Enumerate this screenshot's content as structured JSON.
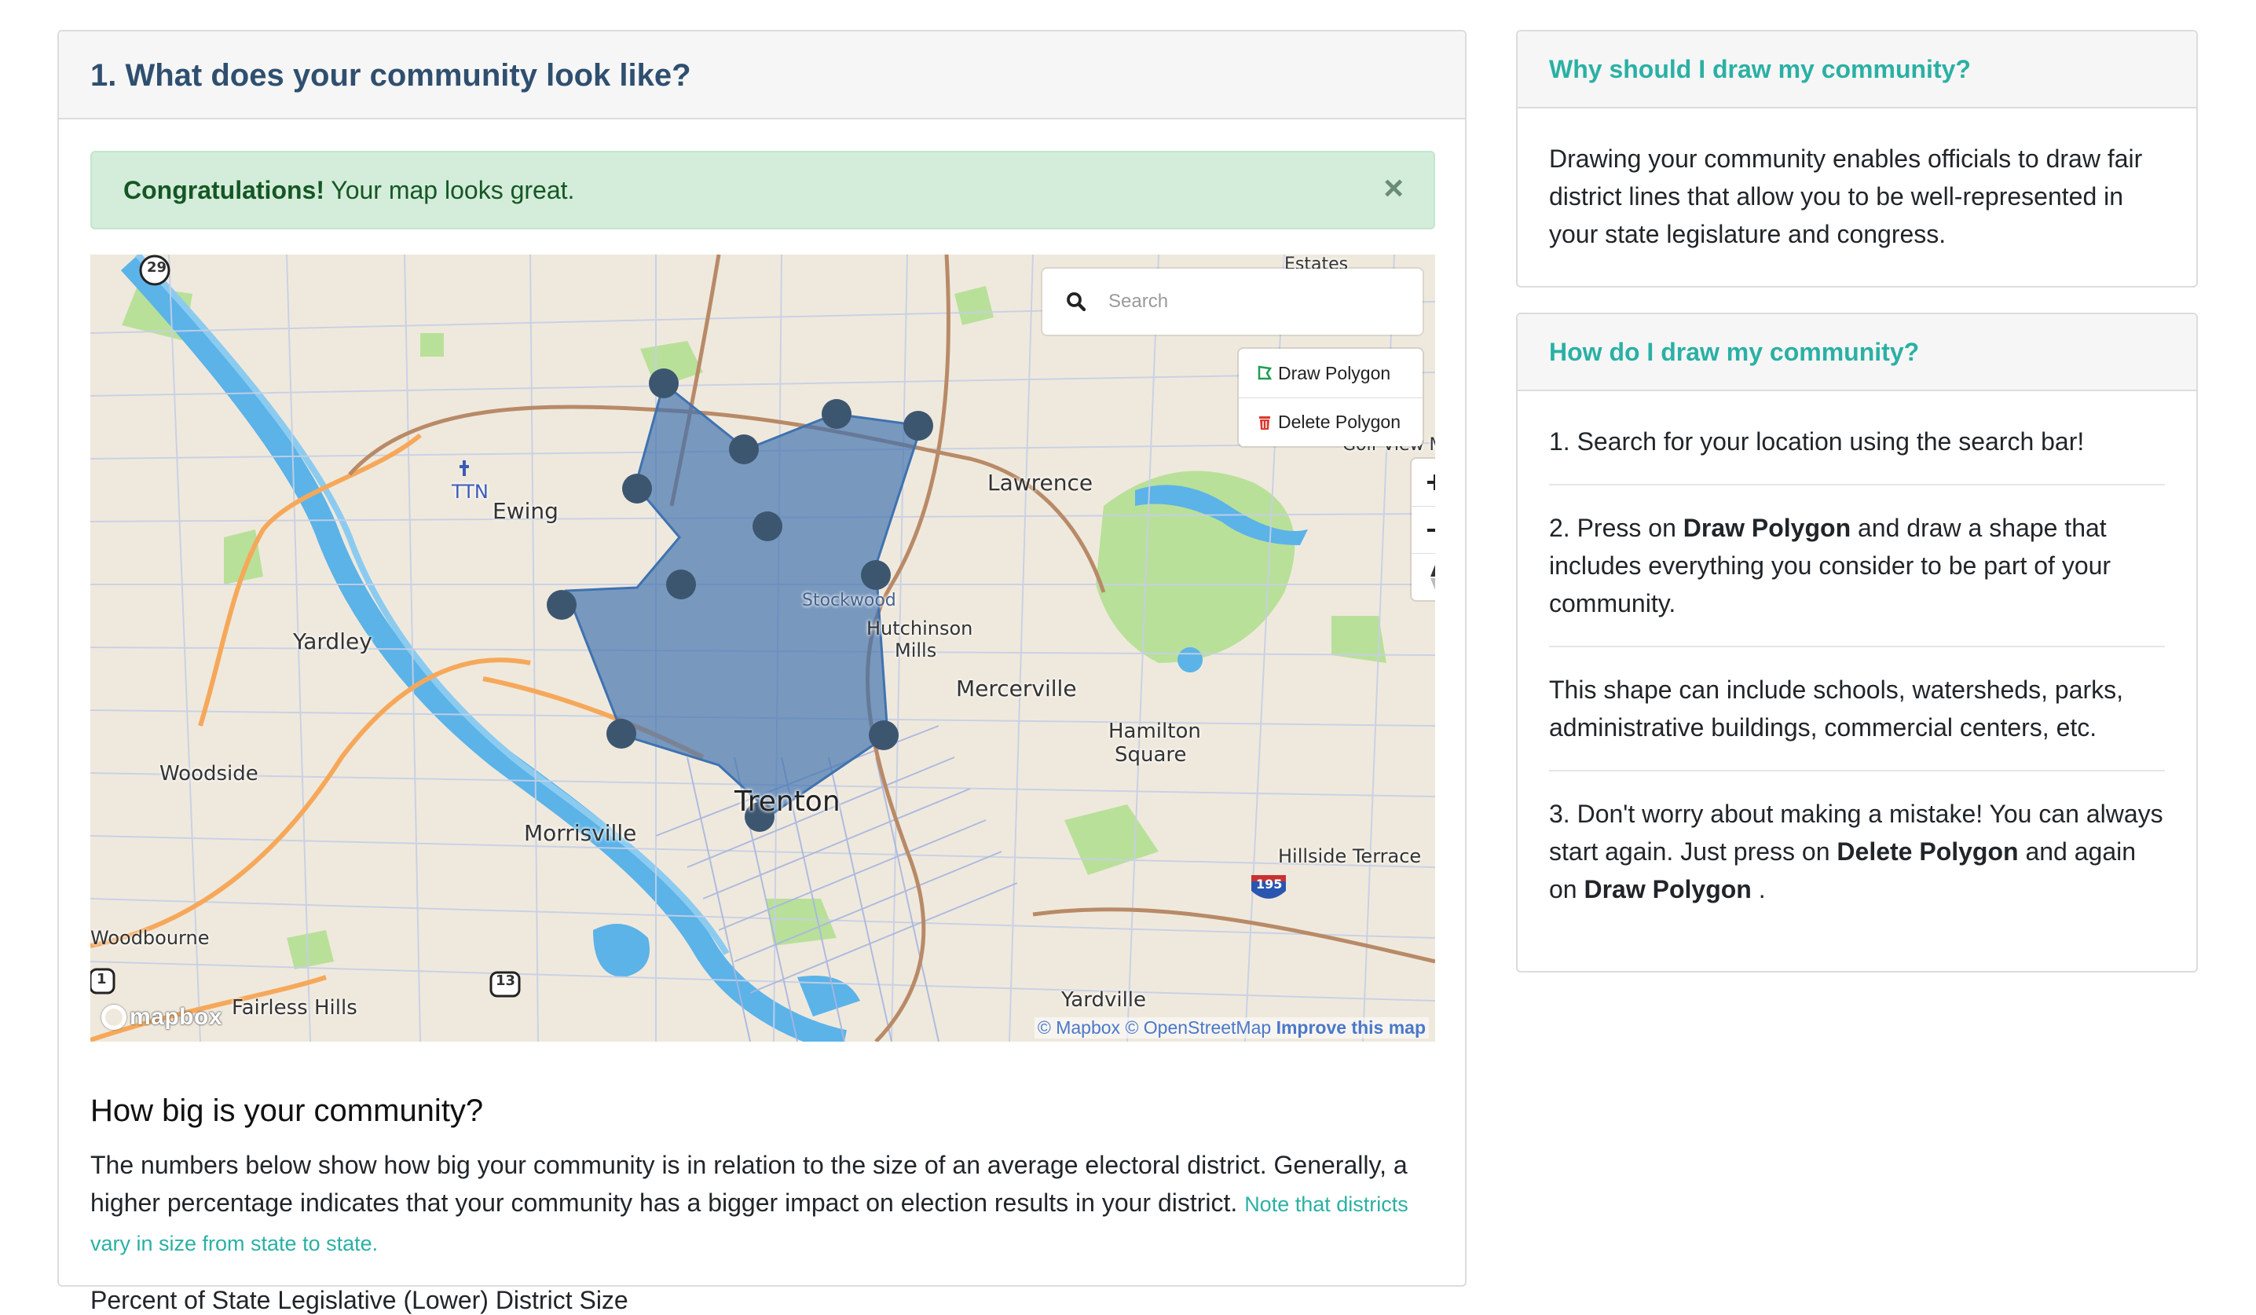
{
  "main": {
    "title": "1. What does your community look like?",
    "alert": {
      "strong": "Congratulations!",
      "text": " Your map looks great.",
      "close_label": "×"
    },
    "map": {
      "search_placeholder": "Search",
      "draw_polygon_label": "Draw Polygon",
      "delete_polygon_label": "Delete Polygon",
      "zoom_in_label": "+",
      "zoom_out_label": "−",
      "attribution_mapbox": "© Mapbox",
      "attribution_osm": "© OpenStreetMap",
      "attribution_improve": "Improve this map",
      "logo_text": "mapbox",
      "place_labels": {
        "ewing": "Ewing",
        "ttn": "TTN",
        "lawrence": "Lawrence",
        "yardley": "Yardley",
        "hutchinson": "Hutchinson",
        "mills": "Mills",
        "mercerville": "Mercerville",
        "hamilton": "Hamilton",
        "square": "Square",
        "woodside": "Woodside",
        "trenton": "Trenton",
        "morrisville": "Morrisville",
        "hillside": "Hillside Terrace",
        "woodbourne": "Woodbourne",
        "fairless": "Fairless Hills",
        "yardville": "Yardville",
        "golf": "Golf View M",
        "estates": "Estates",
        "stockwood": "Stockwood"
      },
      "shields": {
        "r29": "29",
        "r13": "13",
        "r1": "1",
        "i195": "195"
      },
      "colors": {
        "polygon_fill": "#3f72b0",
        "vertex": "#3d5670",
        "water": "#5bb3e8",
        "park": "#a9dd87"
      }
    },
    "how_big": {
      "heading": "How big is your community?",
      "paragraph": "The numbers below show how big your community is in relation to the size of an average electoral district. Generally, a higher percentage indicates that your community has a bigger impact on election results in your district.",
      "note": "Note that districts vary in size from state to state.",
      "cut_line": "Percent of State Legislative (Lower) District Size"
    }
  },
  "sidebar": {
    "why": {
      "title": "Why should I draw my community?",
      "body": "Drawing your community enables officials to draw fair district lines that allow you to be well-represented in your state legislature and congress."
    },
    "how": {
      "title": "How do I draw my community?",
      "step1": "1. Search for your location using the search bar!",
      "step2_pre": "2. Press on ",
      "step2_bold": "Draw Polygon",
      "step2_post": " and draw a shape that includes everything you consider to be part of your community.",
      "step3": "This shape can include schools, watersheds, parks, administrative buildings, commercial centers, etc.",
      "step4_pre": "3. Don't worry about making a mistake! You can always start again. Just press on ",
      "step4_bold1": "Delete Polygon",
      "step4_mid": " and again on ",
      "step4_bold2": "Draw Polygon",
      "step4_post": " ."
    }
  }
}
